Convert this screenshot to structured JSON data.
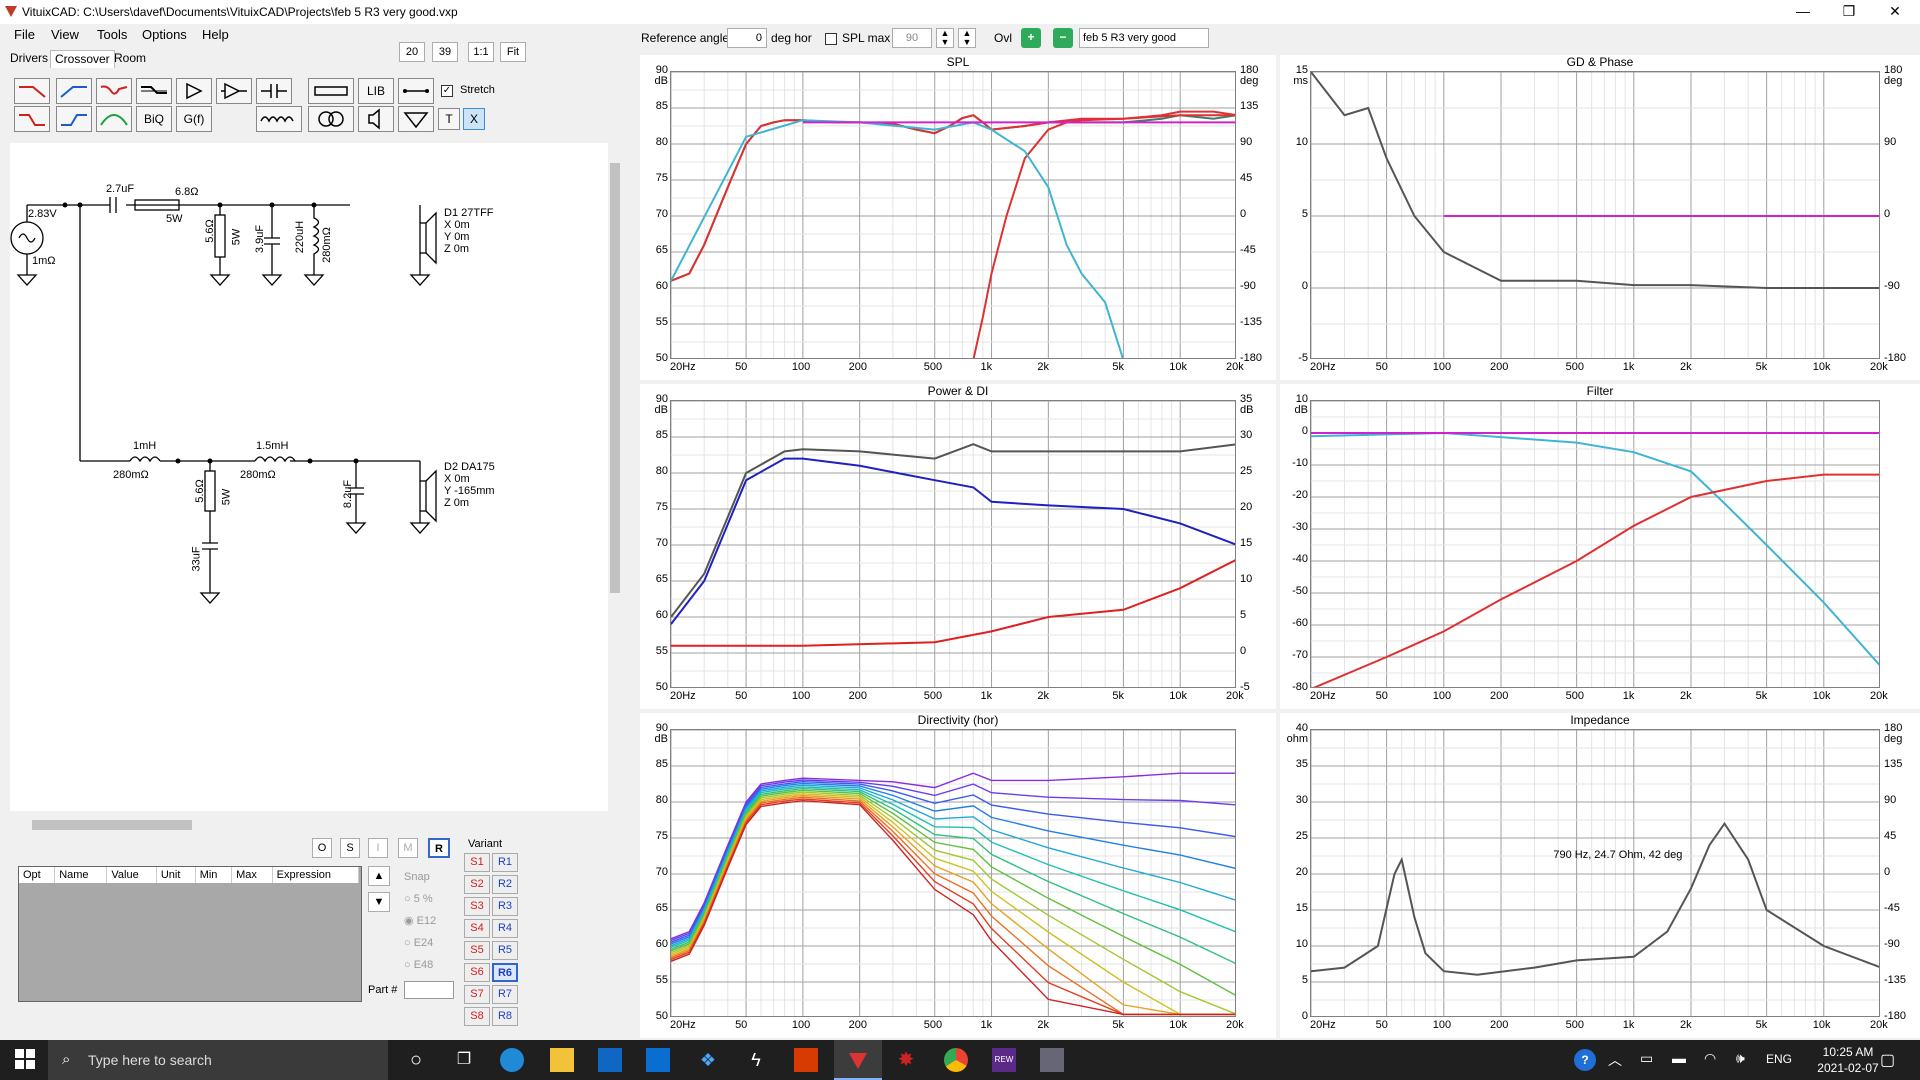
{
  "window": {
    "title": "VituixCAD: C:\\Users\\davef\\Documents\\VituixCAD\\Projects\\feb 5 R3 very good.vxp",
    "minimize_icon": "minimize-icon",
    "maximize_icon": "maximize-icon",
    "close_icon": "close-icon"
  },
  "menu": [
    "File",
    "View",
    "Tools",
    "Options",
    "Help"
  ],
  "tabs": [
    "Drivers",
    "Crossover",
    "Room"
  ],
  "view_controls": {
    "a": "20",
    "b": "39",
    "ratio": "1:1",
    "fit": "Fit"
  },
  "toolbar": {
    "lib": "LIB",
    "biq": "BiQ",
    "gf": "G(f)",
    "stretch": "Stretch",
    "t": "T",
    "x": "X"
  },
  "top": {
    "ref_angle_label": "Reference angle",
    "ref_angle_value": "0",
    "deg_hor": "deg hor",
    "spl_max_label": "SPL max",
    "spl_max_value": "90",
    "ovl": "Ovl",
    "variant_name": "feb 5 R3 very good"
  },
  "schematic": {
    "source_v": "2.83V",
    "source_r": "1mΩ",
    "c1": "2.7uF",
    "r1": "6.8Ω",
    "r1w": "5W",
    "r2": "5.6Ω",
    "r2w": "5W",
    "c2": "3.9uF",
    "l1": "220uH",
    "l1r": "280mΩ",
    "d1": [
      "D1 27TFF",
      "X 0m",
      "Y 0m",
      "Z 0m"
    ],
    "l2": "1mH",
    "l2r": "280mΩ",
    "l3": "1.5mH",
    "l3r": "280mΩ",
    "r3": "5.6Ω",
    "r3w": "5W",
    "c3": "33uF",
    "c4": "8.2uF",
    "d2": [
      "D2 DA175",
      "X 0m",
      "Y -165mm",
      "Z 0m"
    ]
  },
  "opt_buttons": [
    "O",
    "S",
    "I",
    "M",
    "R"
  ],
  "opt_table": {
    "headers": [
      "Opt",
      "Name",
      "Value",
      "Unit",
      "Min",
      "Max",
      "Expression"
    ]
  },
  "snap": {
    "label": "Snap",
    "options": [
      "5 %",
      "E12",
      "E24",
      "E48"
    ]
  },
  "part": {
    "label": "Part #"
  },
  "variant": {
    "label": "Variant",
    "s": [
      "S1",
      "S2",
      "S3",
      "S4",
      "S5",
      "S6",
      "S7",
      "S8"
    ],
    "r": [
      "R1",
      "R2",
      "R3",
      "R4",
      "R5",
      "R6",
      "R7",
      "R8"
    ],
    "selected": "R6"
  },
  "freq_ticks": [
    "20Hz",
    "50",
    "100",
    "200",
    "500",
    "1k",
    "2k",
    "5k",
    "10k",
    "20k"
  ],
  "charts": {
    "spl": {
      "title": "SPL",
      "yl_unit": "dB",
      "yr_unit": "deg",
      "yl": [
        "90",
        "85",
        "80",
        "75",
        "70",
        "65",
        "60",
        "55",
        "50"
      ],
      "yr": [
        "180",
        "135",
        "90",
        "45",
        "0",
        "-45",
        "-90",
        "-135",
        "-180"
      ]
    },
    "gd": {
      "title": "GD & Phase",
      "yl_unit": "ms",
      "yr_unit": "deg",
      "yl": [
        "15",
        "10",
        "5",
        "0",
        "-5"
      ],
      "yr": [
        "180",
        "90",
        "0",
        "-90",
        "-180"
      ]
    },
    "power": {
      "title": "Power & DI",
      "yl_unit": "dB",
      "yr_unit": "dB",
      "yl": [
        "90",
        "85",
        "80",
        "75",
        "70",
        "65",
        "60",
        "55",
        "50"
      ],
      "yr": [
        "35",
        "30",
        "25",
        "20",
        "15",
        "10",
        "5",
        "0",
        "-5"
      ]
    },
    "filter": {
      "title": "Filter",
      "yl_unit": "dB",
      "yl": [
        "10",
        "0",
        "-10",
        "-20",
        "-30",
        "-40",
        "-50",
        "-60",
        "-70",
        "-80"
      ]
    },
    "directivity": {
      "title": "Directivity (hor)",
      "yl_unit": "dB",
      "yl": [
        "90",
        "85",
        "80",
        "75",
        "70",
        "65",
        "60",
        "55",
        "50"
      ]
    },
    "impedance": {
      "title": "Impedance",
      "yl_unit": "ohm",
      "yr_unit": "deg",
      "yl": [
        "40",
        "35",
        "30",
        "25",
        "20",
        "15",
        "10",
        "5",
        "0"
      ],
      "yr": [
        "180",
        "135",
        "90",
        "45",
        "0",
        "-45",
        "-90",
        "-135",
        "-180"
      ],
      "annotation": "790 Hz, 24.7 Ohm, 42 deg"
    }
  },
  "taskbar": {
    "search_placeholder": "Type here to search",
    "lang": "ENG",
    "time": "10:25 AM",
    "date": "2021-02-07"
  },
  "chart_data": [
    {
      "type": "line",
      "title": "SPL",
      "x_scale": "log",
      "xlim": [
        20,
        20000
      ],
      "ylim": [
        50,
        90
      ],
      "y2lim": [
        -180,
        180
      ],
      "series": [
        {
          "color": "#3a7f6f",
          "x": [
            20,
            25,
            30,
            40,
            50,
            60,
            70,
            80,
            100,
            150,
            200,
            300,
            400,
            500,
            600,
            700,
            800,
            900,
            1000,
            1500,
            2000,
            3000,
            5000,
            8000,
            10000,
            15000,
            20000
          ],
          "y": [
            61,
            62,
            66,
            74,
            80,
            82.5,
            83,
            83.3,
            83.3,
            83,
            83,
            82.8,
            82,
            81.5,
            82.5,
            83.6,
            84,
            83,
            82,
            82.5,
            83,
            83,
            83,
            83.5,
            84,
            83.5,
            84
          ]
        },
        {
          "color": "#e03030",
          "x": [
            20,
            25,
            30,
            40,
            50,
            60,
            70,
            80,
            100,
            150,
            200,
            300,
            400,
            500,
            600,
            700,
            800,
            900,
            1000,
            1500,
            2000,
            3000,
            5000,
            8000,
            10000,
            15000,
            20000
          ],
          "y": [
            61,
            62,
            66,
            74,
            80,
            82.5,
            83,
            83.3,
            83.3,
            83,
            83,
            82.8,
            82,
            81.5,
            82.5,
            83.6,
            84,
            83,
            82,
            82.5,
            83,
            83.5,
            83.5,
            84,
            84.5,
            84.5,
            84
          ]
        },
        {
          "color": "#e03030",
          "x": [
            800,
            900,
            1000,
            1200,
            1500,
            2000,
            2500,
            3000,
            5000,
            10000,
            20000
          ],
          "y": [
            50,
            56,
            62,
            70,
            78,
            82,
            83,
            83.3,
            83.5,
            84,
            84
          ]
        },
        {
          "color": "#40b4d4",
          "x": [
            20,
            50,
            100,
            200,
            500,
            800,
            1000,
            1500,
            2000,
            2500,
            3000,
            4000,
            5000
          ],
          "y": [
            61,
            81,
            83.3,
            83,
            82,
            83,
            82,
            79,
            74,
            66,
            62,
            58,
            50
          ]
        },
        {
          "color": "#d020d0",
          "x": [
            100,
            20000
          ],
          "y": [
            83,
            83
          ]
        }
      ]
    },
    {
      "type": "line",
      "title": "GD & Phase",
      "x_scale": "log",
      "xlim": [
        20,
        20000
      ],
      "ylim": [
        -5,
        15
      ],
      "y2lim": [
        -180,
        180
      ],
      "series": [
        {
          "color": "#555555",
          "x": [
            20,
            30,
            40,
            50,
            70,
            100,
            200,
            500,
            1000,
            2000,
            5000,
            20000
          ],
          "y": [
            15,
            12,
            12.5,
            9,
            5,
            2.5,
            0.5,
            0.5,
            0.2,
            0.2,
            0,
            0
          ]
        },
        {
          "color": "#d020d0",
          "x": [
            100,
            20000
          ],
          "y": [
            5,
            5
          ]
        }
      ]
    },
    {
      "type": "line",
      "title": "Power & DI",
      "x_scale": "log",
      "xlim": [
        20,
        20000
      ],
      "ylim": [
        50,
        90
      ],
      "y2lim": [
        -5,
        35
      ],
      "series": [
        {
          "color": "#555555",
          "x": [
            20,
            30,
            50,
            80,
            100,
            200,
            500,
            800,
            1000,
            2000,
            5000,
            10000,
            20000
          ],
          "y": [
            60,
            66,
            80,
            83,
            83.3,
            83,
            82,
            84,
            83,
            83,
            83,
            83,
            84
          ]
        },
        {
          "color": "#2020c0",
          "x": [
            20,
            30,
            50,
            80,
            100,
            200,
            500,
            800,
            1000,
            2000,
            5000,
            10000,
            20000
          ],
          "y": [
            59,
            65,
            79,
            82,
            82,
            81,
            79,
            78,
            76,
            75.5,
            75,
            73,
            70
          ]
        },
        {
          "color": "#e02020",
          "x": [
            20,
            100,
            500,
            1000,
            2000,
            5000,
            10000,
            20000
          ],
          "y": [
            56,
            56,
            56.5,
            58,
            60,
            61,
            64,
            68
          ]
        }
      ]
    },
    {
      "type": "line",
      "title": "Filter",
      "x_scale": "log",
      "xlim": [
        20,
        20000
      ],
      "ylim": [
        -80,
        10
      ],
      "series": [
        {
          "color": "#40b4d4",
          "x": [
            20,
            100,
            500,
            1000,
            2000,
            3000,
            5000,
            10000,
            20000
          ],
          "y": [
            -1,
            0,
            -3,
            -6,
            -12,
            -22,
            -35,
            -53,
            -73
          ]
        },
        {
          "color": "#e03030",
          "x": [
            20,
            50,
            100,
            200,
            500,
            1000,
            2000,
            5000,
            10000,
            20000
          ],
          "y": [
            -80,
            -70,
            -62,
            -52,
            -40,
            -29,
            -20,
            -15,
            -13,
            -13
          ]
        },
        {
          "color": "#d020d0",
          "x": [
            20,
            20000
          ],
          "y": [
            0,
            0
          ]
        }
      ]
    },
    {
      "type": "line",
      "title": "Directivity (hor)",
      "x_scale": "log",
      "xlim": [
        20,
        20000
      ],
      "ylim": [
        50,
        90
      ]
    },
    {
      "type": "line",
      "title": "Impedance",
      "x_scale": "log",
      "xlim": [
        20,
        20000
      ],
      "ylim": [
        0,
        40
      ],
      "y2lim": [
        -180,
        180
      ],
      "series": [
        {
          "color": "#555555",
          "x": [
            20,
            30,
            45,
            55,
            60,
            70,
            80,
            100,
            150,
            300,
            500,
            1000,
            1500,
            2000,
            2500,
            3000,
            4000,
            5000,
            10000,
            20000
          ],
          "y": [
            6.5,
            7,
            10,
            20,
            22,
            14,
            9,
            6.5,
            6,
            7,
            8,
            8.5,
            12,
            18,
            24,
            27,
            22,
            15,
            10,
            7
          ]
        }
      ]
    }
  ]
}
